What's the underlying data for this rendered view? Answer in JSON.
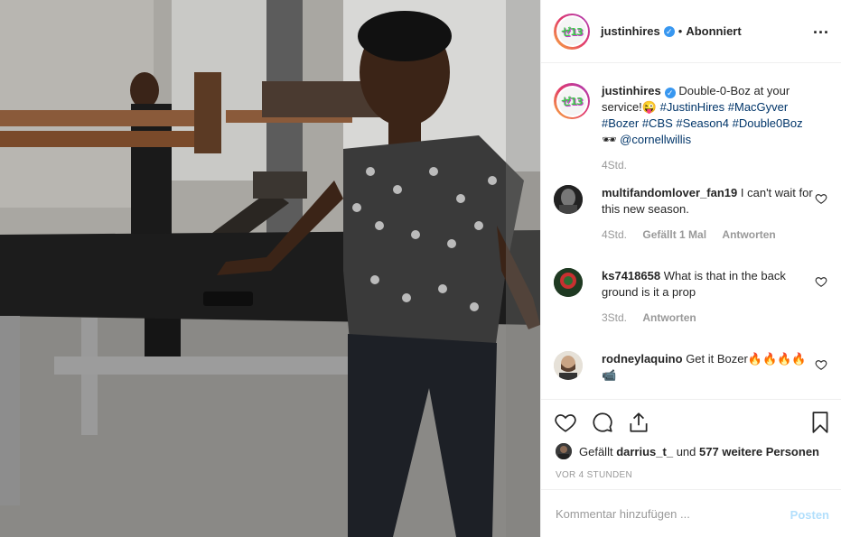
{
  "header": {
    "username": "justinhires",
    "separator": "•",
    "follow_status": "Abonniert",
    "more_label": "..."
  },
  "caption": {
    "username": "justinhires",
    "text_prefix": "Double-0-Boz at your service!😜",
    "hashtags": [
      "#JustinHires",
      "#MacGyver",
      "#Bozer",
      "#CBS",
      "#Season4",
      "#Double0Boz"
    ],
    "glyph": "🕶",
    "mention": "@cornellwillis",
    "time": "4Std."
  },
  "comments": [
    {
      "username": "multifandomlover_fan19",
      "text": "I can't wait for this new season.",
      "time": "4Std.",
      "likes": "Gefällt 1 Mal",
      "reply": "Antworten"
    },
    {
      "username": "ks7418658",
      "text": "What is that in the back ground is it a prop",
      "time": "3Std.",
      "reply": "Antworten"
    },
    {
      "username": "rodneylaquino",
      "text": "Get it Bozer🔥🔥🔥🔥",
      "extra": "📹"
    }
  ],
  "likes": {
    "prefix": "Gefällt",
    "user": "darrius_t_",
    "middle": "und",
    "count_text": "577 weitere Personen"
  },
  "timeago": "VOR 4 STUNDEN",
  "add_comment": {
    "placeholder": "Kommentar hinzufügen ...",
    "post_label": "Posten"
  },
  "colors": {
    "link": "#003569",
    "verified": "#3897f0",
    "post_disabled": "#b2dffc",
    "muted": "#999999"
  }
}
